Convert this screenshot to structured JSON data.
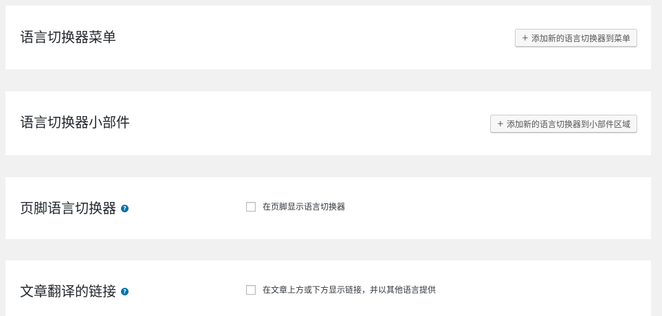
{
  "colors": {
    "page_background": "#f1f1f1",
    "panel_background": "#ffffff",
    "help_icon": "#0073aa"
  },
  "sections": {
    "menu": {
      "title": "语言切换器菜单",
      "button_icon": "+",
      "button_label": "添加新的语言切换器到菜单"
    },
    "widget": {
      "title": "语言切换器小部件",
      "button_icon": "+",
      "button_label": "添加新的语言切换器到小部件区域"
    },
    "footer": {
      "title": "页脚语言切换器",
      "help_icon": "?",
      "checkbox_label": "在页脚显示语言切换器",
      "checked": false
    },
    "post_links": {
      "title": "文章翻译的链接",
      "help_icon": "?",
      "checkbox_label": "在文章上方或下方显示链接，并以其他语言提供",
      "checked": false
    }
  }
}
